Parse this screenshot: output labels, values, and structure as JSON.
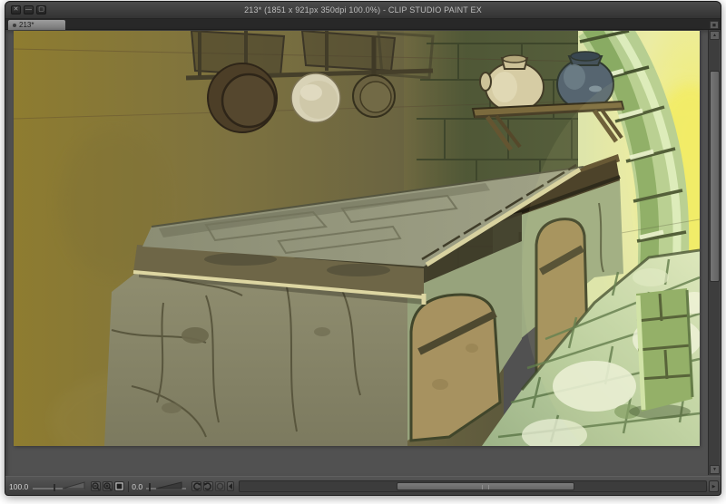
{
  "window": {
    "title": "213* (1851 x 921px 350dpi 100.0%) - CLIP STUDIO PAINT EX",
    "controls": [
      {
        "name": "close",
        "glyph": "✕"
      },
      {
        "name": "minimize",
        "glyph": "—"
      },
      {
        "name": "maximize",
        "glyph": "▢"
      }
    ]
  },
  "tab_bar": {
    "active_tab": {
      "label": "213*",
      "modified": true
    }
  },
  "canvas": {
    "artwork": {
      "subject": "Digital painting of a rustic stone kitchen interior",
      "elements": [
        "mustard-yellow plaster wall on the left",
        "wall rack with hanging brown pan, cream plate and olive pan",
        "wooden shelf holding a cream jar and a blue-grey jar",
        "dark olive stone-brick wall",
        "large stone counter with pale slab top and cracked base",
        "arched tan wooden cabinet doors with diagonal battens",
        "green stone archway with bright yellow light",
        "pale green flagstone floor"
      ]
    }
  },
  "status_bar": {
    "zoom_value": "100.0",
    "rotation_value": "0.0",
    "tools": [
      "zoom-out",
      "zoom-in",
      "fit-to-screen",
      "rotate-counterclockwise",
      "rotate-clockwise",
      "reset-rotation"
    ]
  },
  "colors": {
    "titlebar": "#3f3f3f",
    "tab_active": "#8f8f8f",
    "pasteboard": "#515151",
    "statusbar": "#474747",
    "wall_left": "#8d7b31",
    "wall_right": "#535b3a",
    "arch_light": "#f2ed6c",
    "arch_stone": "#b6ce91",
    "floor": "#b9cda1",
    "counter_top": "#95977c",
    "counter_base": "#87856a",
    "door_wood": "#a79260",
    "slab_edge_highlight": "#ddd6a2",
    "jar_cream": "#d6cca4",
    "jar_blue": "#566570"
  }
}
